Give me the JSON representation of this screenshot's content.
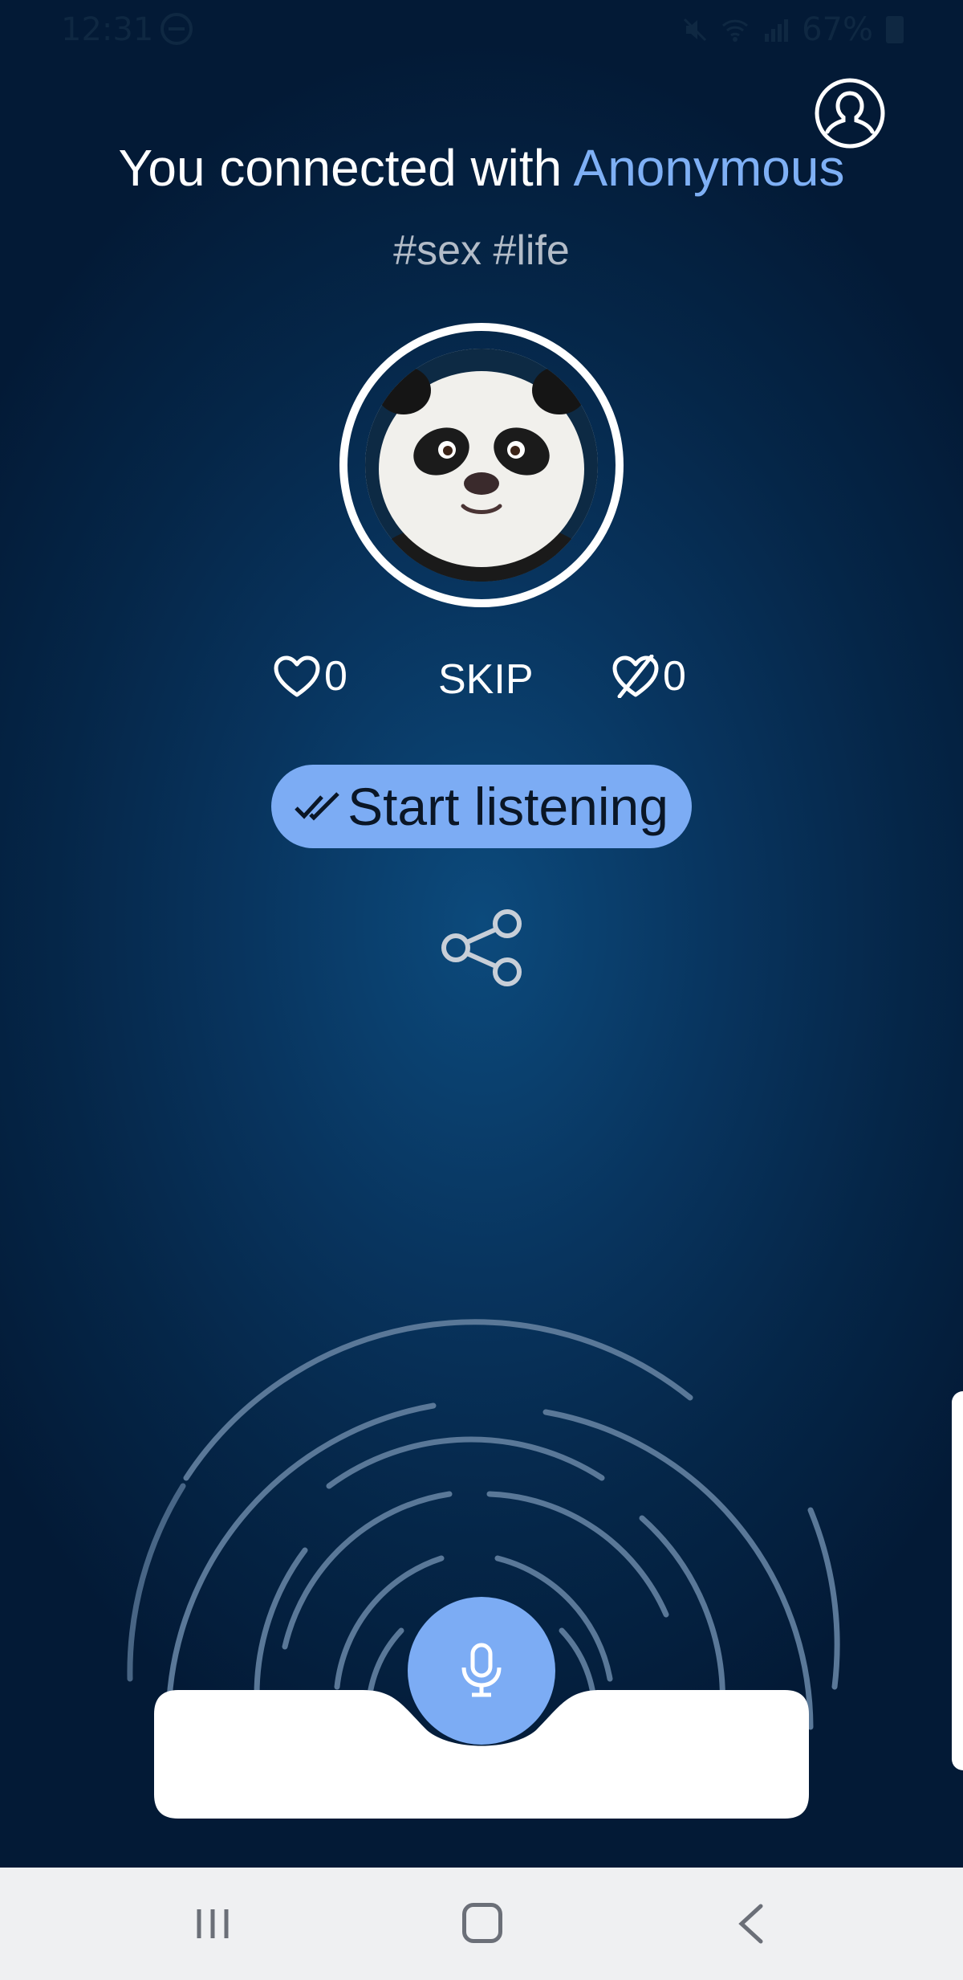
{
  "status_bar": {
    "time": "12:31",
    "battery": "67%"
  },
  "header": {
    "title_prefix": "You connected with",
    "partner_name": "Anonymous",
    "tags": "#sex #life",
    "profile_icon": "user-circle-icon"
  },
  "avatar": {
    "icon": "panda-avatar"
  },
  "actions": {
    "like_count": "0",
    "skip_label": "SKIP",
    "dislike_count": "0"
  },
  "listen_button": {
    "label": "Start listening",
    "icon": "double-check-icon"
  },
  "share": {
    "icon": "share-icon"
  },
  "mic": {
    "icon": "microphone-icon"
  },
  "navigation": {
    "recent_icon": "recent-apps-icon",
    "home_icon": "home-icon",
    "back_icon": "back-icon"
  },
  "colors": {
    "accent": "#7cacf4",
    "background_dark": "#031a36",
    "background_glow": "#0c4a7c",
    "partner_name": "#7fb0f5"
  }
}
